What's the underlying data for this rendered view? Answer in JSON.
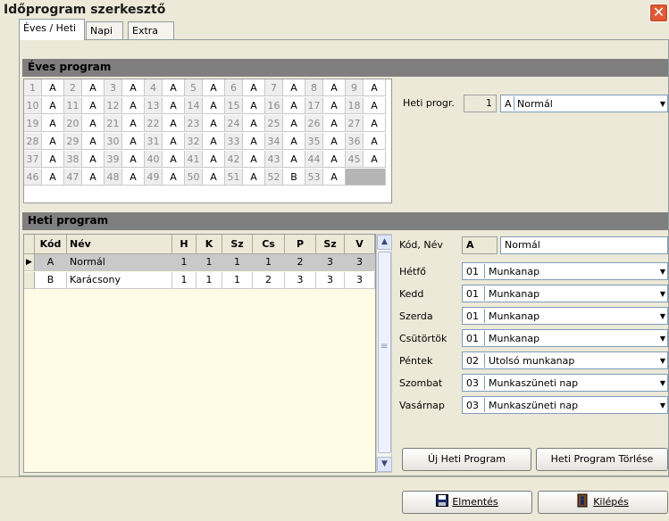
{
  "window": {
    "title": "Időprogram szerkesztő",
    "close_glyph": "✕"
  },
  "tabs": [
    {
      "label": "Éves / Heti",
      "active": true
    },
    {
      "label": "Napi",
      "active": false
    },
    {
      "label": "Extra",
      "active": false
    }
  ],
  "annual": {
    "header": "Éves program",
    "weeks": [
      {
        "n": "1",
        "v": "A"
      },
      {
        "n": "2",
        "v": "A"
      },
      {
        "n": "3",
        "v": "A"
      },
      {
        "n": "4",
        "v": "A"
      },
      {
        "n": "5",
        "v": "A"
      },
      {
        "n": "6",
        "v": "A"
      },
      {
        "n": "7",
        "v": "A"
      },
      {
        "n": "8",
        "v": "A"
      },
      {
        "n": "9",
        "v": "A"
      },
      {
        "n": "10",
        "v": "A"
      },
      {
        "n": "11",
        "v": "A"
      },
      {
        "n": "12",
        "v": "A"
      },
      {
        "n": "13",
        "v": "A"
      },
      {
        "n": "14",
        "v": "A"
      },
      {
        "n": "15",
        "v": "A"
      },
      {
        "n": "16",
        "v": "A"
      },
      {
        "n": "17",
        "v": "A"
      },
      {
        "n": "18",
        "v": "A"
      },
      {
        "n": "19",
        "v": "A"
      },
      {
        "n": "20",
        "v": "A"
      },
      {
        "n": "21",
        "v": "A"
      },
      {
        "n": "22",
        "v": "A"
      },
      {
        "n": "23",
        "v": "A"
      },
      {
        "n": "24",
        "v": "A"
      },
      {
        "n": "25",
        "v": "A"
      },
      {
        "n": "26",
        "v": "A"
      },
      {
        "n": "27",
        "v": "A"
      },
      {
        "n": "28",
        "v": "A"
      },
      {
        "n": "29",
        "v": "A"
      },
      {
        "n": "30",
        "v": "A"
      },
      {
        "n": "31",
        "v": "A"
      },
      {
        "n": "32",
        "v": "A"
      },
      {
        "n": "33",
        "v": "A"
      },
      {
        "n": "34",
        "v": "A"
      },
      {
        "n": "35",
        "v": "A"
      },
      {
        "n": "36",
        "v": "A"
      },
      {
        "n": "37",
        "v": "A"
      },
      {
        "n": "38",
        "v": "A"
      },
      {
        "n": "39",
        "v": "A"
      },
      {
        "n": "40",
        "v": "A"
      },
      {
        "n": "41",
        "v": "A"
      },
      {
        "n": "42",
        "v": "A"
      },
      {
        "n": "43",
        "v": "A"
      },
      {
        "n": "44",
        "v": "A"
      },
      {
        "n": "45",
        "v": "A"
      },
      {
        "n": "46",
        "v": "A"
      },
      {
        "n": "47",
        "v": "A"
      },
      {
        "n": "48",
        "v": "A"
      },
      {
        "n": "49",
        "v": "A"
      },
      {
        "n": "50",
        "v": "A"
      },
      {
        "n": "51",
        "v": "A"
      },
      {
        "n": "52",
        "v": "B"
      },
      {
        "n": "53",
        "v": "A"
      }
    ],
    "heti_progr_label": "Heti progr.",
    "heti_progr_week": "1",
    "heti_progr_code": "A",
    "heti_progr_name": "Normál"
  },
  "weekly": {
    "header": "Heti program",
    "columns": [
      "Kód",
      "Név",
      "H",
      "K",
      "Sz",
      "Cs",
      "P",
      "Sz",
      "V"
    ],
    "rows": [
      {
        "selected": true,
        "cells": [
          "A",
          "Normál",
          "1",
          "1",
          "1",
          "1",
          "2",
          "3",
          "3"
        ]
      },
      {
        "selected": false,
        "cells": [
          "B",
          "Karácsony",
          "1",
          "1",
          "1",
          "2",
          "3",
          "3",
          "3"
        ]
      }
    ],
    "scroll_up": "▲",
    "scroll_down": "▼",
    "scroll_grip": "≡"
  },
  "detail": {
    "kod_nev_label": "Kód, Név",
    "kod_value": "A",
    "nev_value": "Normál",
    "days": [
      {
        "label": "Hétfő",
        "code": "01",
        "name": "Munkanap"
      },
      {
        "label": "Kedd",
        "code": "01",
        "name": "Munkanap"
      },
      {
        "label": "Szerda",
        "code": "01",
        "name": "Munkanap"
      },
      {
        "label": "Csütörtök",
        "code": "01",
        "name": "Munkanap"
      },
      {
        "label": "Péntek",
        "code": "02",
        "name": "Utolsó munkanap"
      },
      {
        "label": "Szombat",
        "code": "03",
        "name": "Munkaszüneti nap"
      },
      {
        "label": "Vasárnap",
        "code": "03",
        "name": "Munkaszüneti nap"
      }
    ],
    "new_button": "Új Heti Program",
    "delete_button": "Heti Program Törlése"
  },
  "footer": {
    "save_button": "Elmentés",
    "exit_button": "Kilépés"
  },
  "colors": {
    "section_header": "#7f7f7f",
    "grid_disabled": "#eeeeee",
    "selected_row": "#c9c9c9",
    "close_button": "#e05a35"
  },
  "icons": {
    "save": "floppy-disk-icon",
    "exit": "exit-door-icon",
    "dropdown": "dropdown-arrow-icon",
    "row_pointer": "row-pointer-icon"
  }
}
